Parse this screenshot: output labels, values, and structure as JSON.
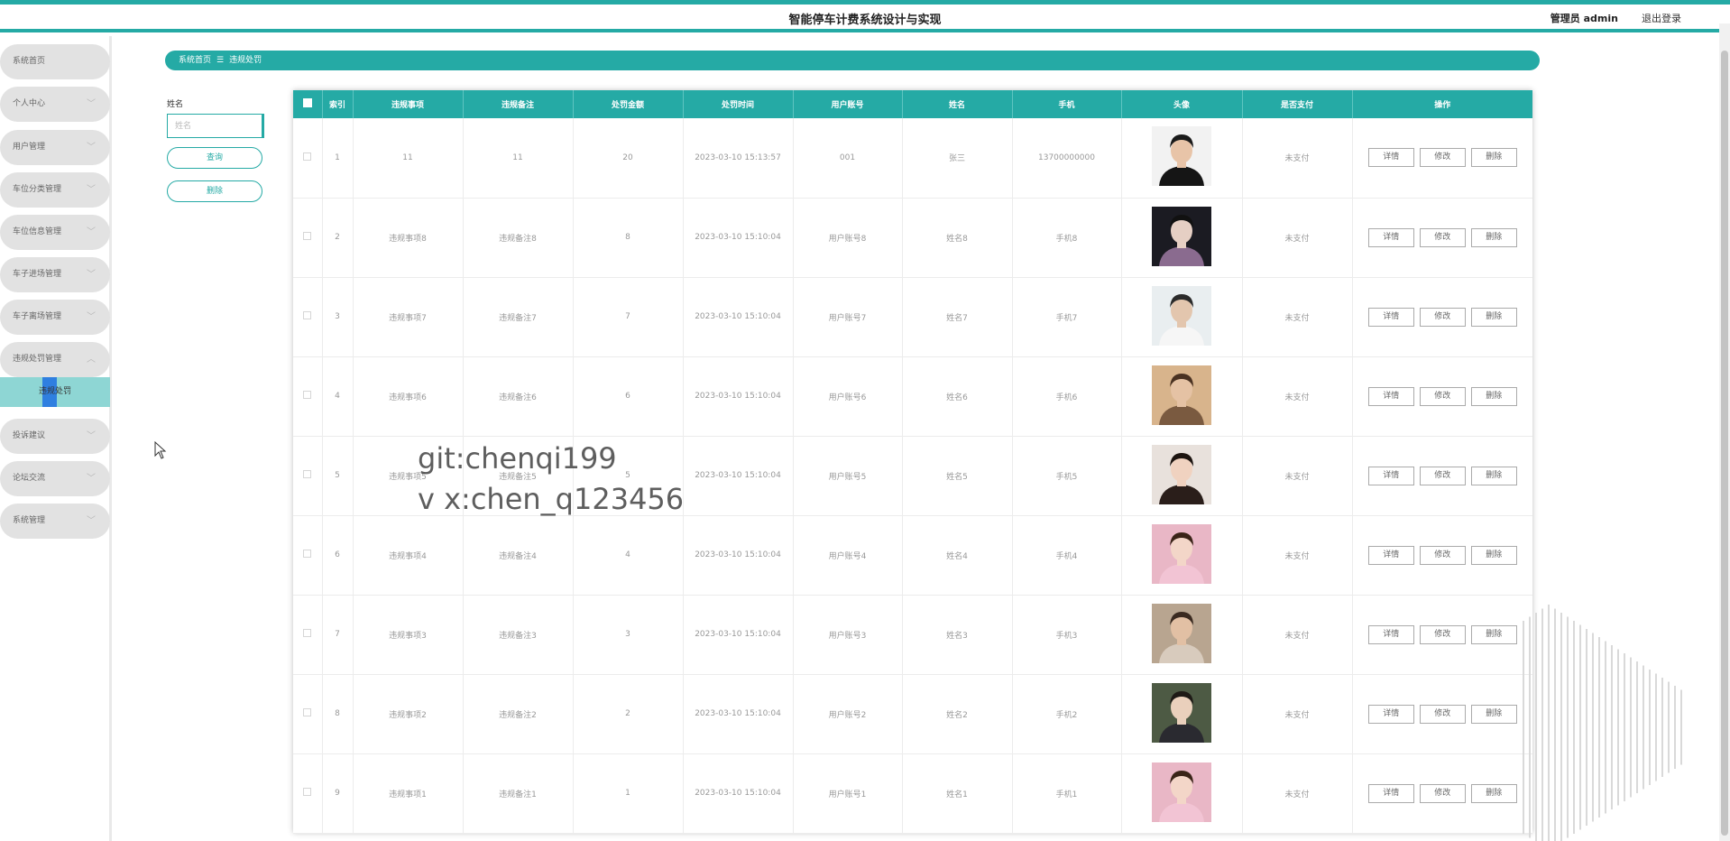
{
  "header": {
    "title": "智能停车计费系统设计与实现",
    "admin": "管理员 admin",
    "logout": "退出登录"
  },
  "sidebar": {
    "items": [
      {
        "label": "系统首页",
        "chevron": false
      },
      {
        "label": "个人中心",
        "chevron": true
      },
      {
        "label": "用户管理",
        "chevron": true
      },
      {
        "label": "车位分类管理",
        "chevron": true
      },
      {
        "label": "车位信息管理",
        "chevron": true
      },
      {
        "label": "车子进场管理",
        "chevron": true
      },
      {
        "label": "车子离场管理",
        "chevron": true
      },
      {
        "label": "违规处罚管理",
        "chevron": true,
        "expanded": true
      },
      {
        "label": "投诉建议",
        "chevron": true
      },
      {
        "label": "论坛交流",
        "chevron": true
      },
      {
        "label": "系统管理",
        "chevron": true
      }
    ],
    "submenu_label": "违规处罚"
  },
  "breadcrumb": {
    "home": "系统首页",
    "separator": "☰",
    "current": "违规处罚"
  },
  "search": {
    "label": "姓名",
    "placeholder": "姓名",
    "query_button": "查询",
    "delete_button": "删除"
  },
  "table": {
    "headers": [
      "",
      "索引",
      "违规事项",
      "违规备注",
      "处罚金额",
      "处罚时间",
      "用户账号",
      "姓名",
      "手机",
      "头像",
      "是否支付",
      "操作"
    ],
    "actions": [
      "详情",
      "修改",
      "删除"
    ],
    "rows": [
      {
        "index": "1",
        "item": "11",
        "note": "11",
        "amount": "20",
        "time": "2023-03-10 15:13:57",
        "account": "001",
        "name": "张三",
        "phone": "13700000000",
        "paid": "未支付",
        "avatar": "avatar-man-white-shirt"
      },
      {
        "index": "2",
        "item": "违规事项8",
        "note": "违规备注8",
        "amount": "8",
        "time": "2023-03-10 15:10:04",
        "account": "用户账号8",
        "name": "姓名8",
        "phone": "手机8",
        "paid": "未支付",
        "avatar": "avatar-man-dark"
      },
      {
        "index": "3",
        "item": "违规事项7",
        "note": "违规备注7",
        "amount": "7",
        "time": "2023-03-10 15:10:04",
        "account": "用户账号7",
        "name": "姓名7",
        "phone": "手机7",
        "paid": "未支付",
        "avatar": "avatar-man-full-body"
      },
      {
        "index": "4",
        "item": "违规事项6",
        "note": "违规备注6",
        "amount": "6",
        "time": "2023-03-10 15:10:04",
        "account": "用户账号6",
        "name": "姓名6",
        "phone": "手机6",
        "paid": "未支付",
        "avatar": "avatar-man-portrait"
      },
      {
        "index": "5",
        "item": "违规事项5",
        "note": "违规备注5",
        "amount": "5",
        "time": "2023-03-10 15:10:04",
        "account": "用户账号5",
        "name": "姓名5",
        "phone": "手机5",
        "paid": "未支付",
        "avatar": "avatar-woman-dark-hair"
      },
      {
        "index": "6",
        "item": "违规事项4",
        "note": "违规备注4",
        "amount": "4",
        "time": "2023-03-10 15:10:04",
        "account": "用户账号4",
        "name": "姓名4",
        "phone": "手机4",
        "paid": "未支付",
        "avatar": "avatar-woman-pink"
      },
      {
        "index": "7",
        "item": "违规事项3",
        "note": "违规备注3",
        "amount": "3",
        "time": "2023-03-10 15:10:04",
        "account": "用户账号3",
        "name": "姓名3",
        "phone": "手机3",
        "paid": "未支付",
        "avatar": "avatar-man-hand"
      },
      {
        "index": "8",
        "item": "违规事项2",
        "note": "违规备注2",
        "amount": "2",
        "time": "2023-03-10 15:10:04",
        "account": "用户账号2",
        "name": "姓名2",
        "phone": "手机2",
        "paid": "未支付",
        "avatar": "avatar-man-suit"
      },
      {
        "index": "9",
        "item": "违规事项1",
        "note": "违规备注1",
        "amount": "1",
        "time": "2023-03-10 15:10:04",
        "account": "用户账号1",
        "name": "姓名1",
        "phone": "手机1",
        "paid": "未支付",
        "avatar": "avatar-woman-pink"
      }
    ]
  },
  "watermark": {
    "line1": "git:chenqi199",
    "line2": "v x:chen_q123456"
  },
  "colors": {
    "accent": "#25aaa5",
    "submenu_active": "#8ed6d4",
    "sidebar_item": "#e2e2e2"
  }
}
